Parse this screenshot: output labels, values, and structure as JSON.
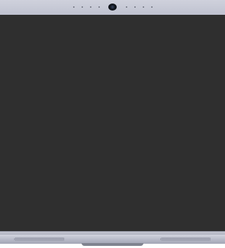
{
  "device": {
    "type": "laptop",
    "screen_state": "off",
    "colors": {
      "screen": "#2f2f2f",
      "bezel": "#bfc2d0",
      "body": "#b3b6c6"
    },
    "icons": [
      "camera-icon"
    ]
  }
}
